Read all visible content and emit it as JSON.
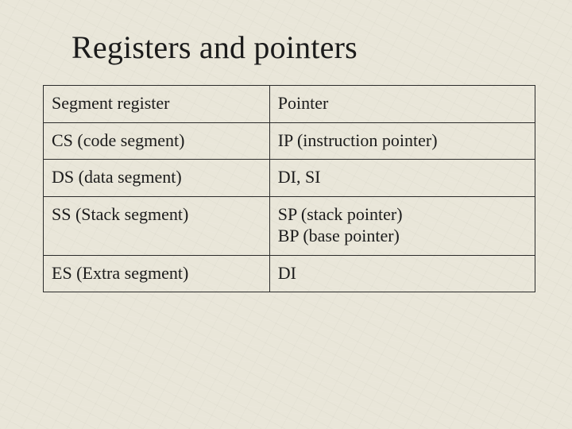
{
  "title": "Registers and pointers",
  "table": {
    "headers": {
      "c0": "Segment register",
      "c1": "Pointer"
    },
    "rows": [
      {
        "c0": "CS (code segment)",
        "c1": "IP (instruction pointer)"
      },
      {
        "c0": "DS (data segment)",
        "c1": "DI, SI"
      },
      {
        "c0": "SS (Stack segment)",
        "c1": "SP (stack pointer)\nBP (base pointer)"
      },
      {
        "c0": "ES (Extra segment)",
        "c1": "DI"
      }
    ]
  }
}
